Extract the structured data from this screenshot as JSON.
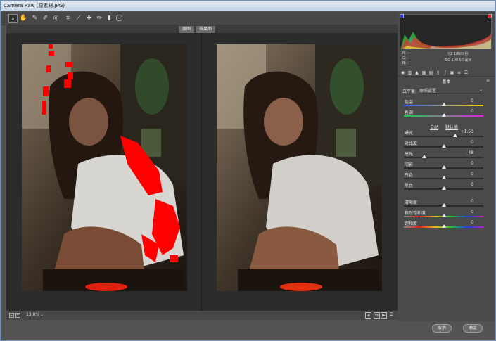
{
  "window": {
    "title": "Camera Raw (原素材.JPG)"
  },
  "toolbar": {
    "tools": [
      "zoom-icon",
      "hand-icon",
      "white-balance-icon",
      "color-sampler-icon",
      "target-adjust-icon",
      "crop-icon",
      "straighten-icon",
      "spot-removal-icon",
      "red-eye-icon",
      "adjustment-brush-icon",
      "graduated-filter-icon",
      "radial-filter-icon"
    ]
  },
  "viewer": {
    "before_label": "原图",
    "after_label": "效果图"
  },
  "statusbar": {
    "zoom_value": "13.8%",
    "zoom_caret": "⌄"
  },
  "histogram": {
    "rgb": [
      "R: ---",
      "G: ---",
      "B: ---"
    ],
    "camera_info_1": "f/2  1/800 秒",
    "camera_info_2": "ISO 100  50 毫米",
    "colors": {
      "shadow_clip": "#1a3cff",
      "highlight_clip": "#e81818"
    }
  },
  "panel": {
    "section_title": "基本",
    "white_balance_label": "白平衡:",
    "white_balance_value": "原照设置",
    "auto_label": "自动",
    "default_label": "默认值",
    "sliders": {
      "temperature": {
        "label": "色温",
        "value": "0",
        "pos": 0.5
      },
      "tint": {
        "label": "色调",
        "value": "0",
        "pos": 0.5
      },
      "exposure": {
        "label": "曝光",
        "value": "+1.50",
        "pos": 0.65
      },
      "contrast": {
        "label": "对比度",
        "value": "0",
        "pos": 0.5
      },
      "highlights": {
        "label": "高光",
        "value": "-48",
        "pos": 0.26
      },
      "shadows": {
        "label": "阴影",
        "value": "0",
        "pos": 0.5
      },
      "whites": {
        "label": "白色",
        "value": "0",
        "pos": 0.5
      },
      "blacks": {
        "label": "黑色",
        "value": "0",
        "pos": 0.5
      },
      "clarity": {
        "label": "清晰度",
        "value": "0",
        "pos": 0.5
      },
      "vibrance": {
        "label": "自然饱和度",
        "value": "0",
        "pos": 0.5
      },
      "saturation": {
        "label": "饱和度",
        "value": "0",
        "pos": 0.5
      }
    }
  },
  "footer": {
    "cancel_label": "取消",
    "ok_label": "确定"
  }
}
